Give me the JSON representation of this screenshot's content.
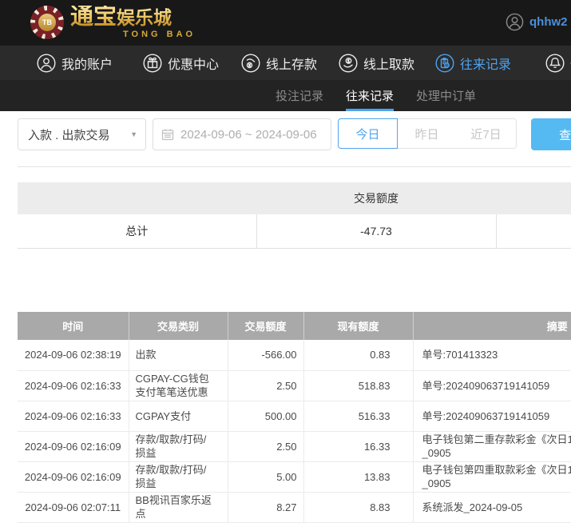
{
  "brand": {
    "chip": "TB",
    "name_big": "通宝",
    "name_small": "娱乐城",
    "name_en": "TONG BAO"
  },
  "user": {
    "name": "qhhw2"
  },
  "nav": {
    "account": "我的账户",
    "promo": "优惠中心",
    "deposit": "线上存款",
    "withdraw": "线上取款",
    "records": "往来记录",
    "messages": "信息"
  },
  "tabs": {
    "bet_records": "投注记录",
    "transaction_records": "往来记录",
    "pending_orders": "处理中订单"
  },
  "filters": {
    "type_select_value": "入款 . 出款交易",
    "date_range_value": "2024-09-06 ~ 2024-09-06",
    "today": "今日",
    "yesterday": "昨日",
    "last7days": "近7日",
    "search": "查询"
  },
  "summary": {
    "header": "交易额度",
    "total_label": "总计",
    "total_value": "-47.73"
  },
  "table": {
    "headers": {
      "time": "时间",
      "type": "交易类别",
      "amount": "交易额度",
      "balance": "现有额度",
      "summary": "摘要"
    },
    "rows": [
      {
        "time": "2024-09-06 02:38:19",
        "type": "出款",
        "amount": "-566.00",
        "balance": "0.83",
        "summary": "单号:701413323"
      },
      {
        "time": "2024-09-06 02:16:33",
        "type": "CGPAY-CG钱包\n支付笔笔送优惠",
        "amount": "2.50",
        "balance": "518.83",
        "summary": "单号:202409063719141059"
      },
      {
        "time": "2024-09-06 02:16:33",
        "type": "CGPAY支付",
        "amount": "500.00",
        "balance": "516.33",
        "summary": "单号:202409063719141059"
      },
      {
        "time": "2024-09-06 02:16:09",
        "type": "存款/取款/打码/\n损益",
        "amount": "2.50",
        "balance": "16.33",
        "summary": "电子钱包第二重存款彩金《次日1\n_0905"
      },
      {
        "time": "2024-09-06 02:16:09",
        "type": "存款/取款/打码/\n损益",
        "amount": "5.00",
        "balance": "13.83",
        "summary": "电子钱包第四重取款彩金《次日1\n_0905"
      },
      {
        "time": "2024-09-06 02:07:11",
        "type": "BB视讯百家乐返\n点",
        "amount": "8.27",
        "balance": "8.83",
        "summary": "系统派发_2024-09-05"
      }
    ]
  },
  "colors": {
    "accent_blue": "#4da3f0",
    "search_button_blue": "#55b9f2",
    "username_blue": "#4a90d9"
  }
}
